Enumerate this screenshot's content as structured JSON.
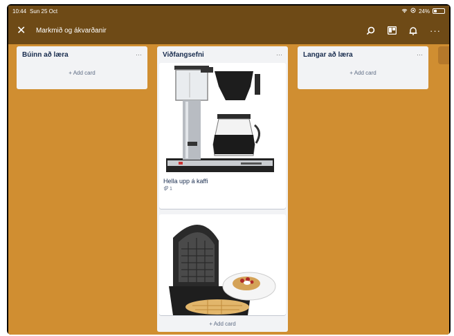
{
  "status_bar": {
    "time": "10:44",
    "date": "Sun 25 Oct",
    "battery": "24%"
  },
  "header": {
    "title": "Markmið og ákvarðanir"
  },
  "lists": [
    {
      "title": "Búinn að læra",
      "add_label": "+ Add card"
    },
    {
      "title": "Viðfangsefni",
      "add_label": "+ Add card"
    },
    {
      "title": "Langar að læra",
      "add_label": "+ Add card"
    }
  ],
  "cards": [
    {
      "title": "Hella upp á kaffi",
      "attachments": "1",
      "image": "coffee-maker-image"
    },
    {
      "title": "",
      "image": "waffle-iron-image"
    }
  ],
  "colors": {
    "board_bg": "#d08e31",
    "header_bg": "#6e4a16",
    "list_bg": "#f2f3f5"
  }
}
